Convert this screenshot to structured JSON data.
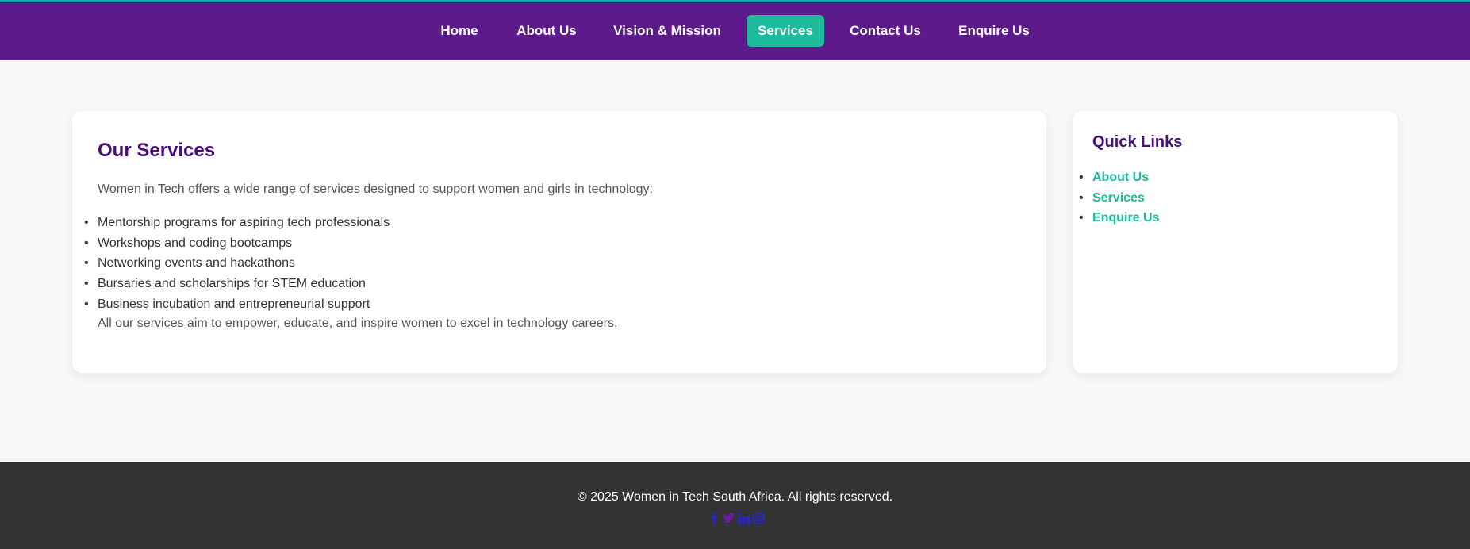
{
  "nav": {
    "items": [
      {
        "label": "Home"
      },
      {
        "label": "About Us"
      },
      {
        "label": "Vision & Mission"
      },
      {
        "label": "Services",
        "active": true
      },
      {
        "label": "Contact Us"
      },
      {
        "label": "Enquire Us"
      }
    ]
  },
  "main": {
    "title": "Our Services",
    "intro": "Women in Tech offers a wide range of services designed to support women and girls in technology:",
    "services": [
      "Mentorship programs for aspiring tech professionals",
      "Workshops and coding bootcamps",
      "Networking events and hackathons",
      "Bursaries and scholarships for STEM education",
      "Business incubation and entrepreneurial support"
    ],
    "outro": "All our services aim to empower, educate, and inspire women to excel in technology careers."
  },
  "sidebar": {
    "title": "Quick Links",
    "links": [
      "About Us",
      "Services",
      "Enquire Us"
    ]
  },
  "footer": {
    "copyright": "© 2025 Women in Tech South Africa. All rights reserved.",
    "socials": [
      "facebook-icon",
      "twitter-icon",
      "linkedin-icon",
      "instagram-icon"
    ]
  },
  "colors": {
    "nav_bg": "#5c1a8b",
    "accent": "#1abc9c",
    "heading": "#4a0e78",
    "footer_bg": "#333333",
    "social_blue": "#2323e6",
    "social_purple": "#6a1b9a"
  }
}
